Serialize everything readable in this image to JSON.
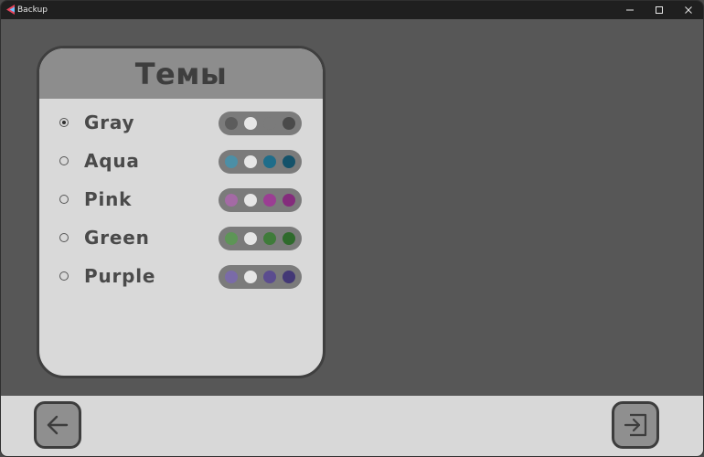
{
  "window": {
    "title": "Backup",
    "controls": [
      "minimize-icon",
      "maximize-icon",
      "close-icon"
    ]
  },
  "panel": {
    "title": "Темы",
    "themes": [
      {
        "label": "Gray",
        "selected": true,
        "colors": [
          "#5c5c5c",
          "#e6e6e6",
          "#7b7b7b",
          "#4a4a4a"
        ]
      },
      {
        "label": "Aqua",
        "selected": false,
        "colors": [
          "#4c8fa6",
          "#e6e6e6",
          "#1f6d8a",
          "#14526a"
        ]
      },
      {
        "label": "Pink",
        "selected": false,
        "colors": [
          "#a46aa5",
          "#e6e6e6",
          "#9b3e93",
          "#842c7c"
        ]
      },
      {
        "label": "Green",
        "selected": false,
        "colors": [
          "#5d9556",
          "#e6e6e6",
          "#3f7b3a",
          "#2f6a2c"
        ]
      },
      {
        "label": "Purple",
        "selected": false,
        "colors": [
          "#7a6ba8",
          "#e6e6e6",
          "#5b4c8f",
          "#433876"
        ]
      }
    ]
  },
  "footer": {
    "back_icon": "arrow-left-icon",
    "exit_icon": "exit-icon"
  },
  "colors": {
    "background": "#575757",
    "panel": "#d9d9d9",
    "panel_header": "#8d8d8d",
    "footer": "#d8d8d8",
    "button": "#8f8f8f",
    "titlebar": "#1f1f1f"
  }
}
